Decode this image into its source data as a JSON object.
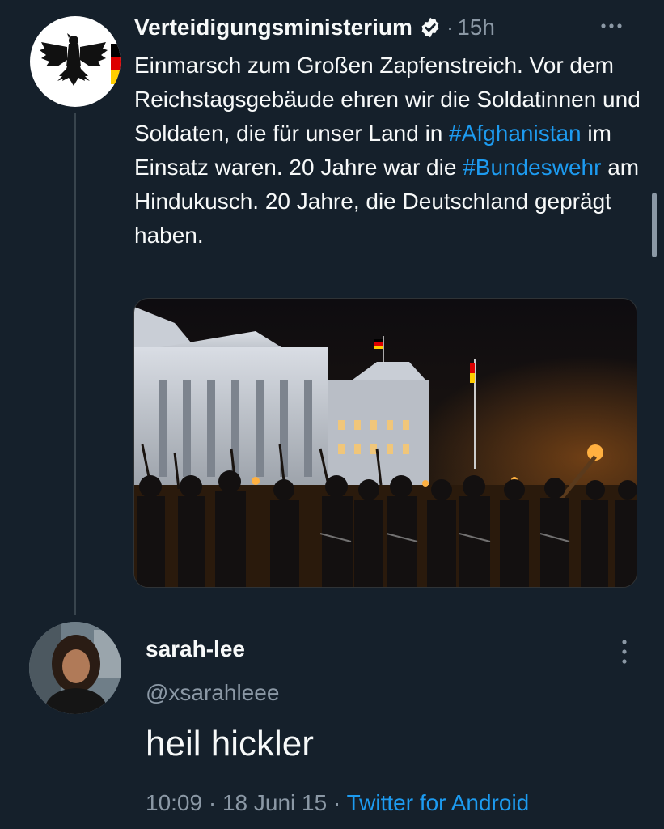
{
  "tweet": {
    "author_name": "Verteidigungsministerium",
    "time_ago": "15h",
    "separator": "·",
    "verified_icon": "verified-badge-icon",
    "more_icon": "more-horizontal-icon",
    "avatar_icon": "federal-eagle-icon",
    "text_parts": [
      {
        "text": "Einmarsch zum Großen Zapfenstreich. Vor dem Reichstagsgebäude ehren wir die Soldatinnen und Soldaten, die für unser Land in ",
        "type": "text"
      },
      {
        "text": "#Afghanistan",
        "type": "hashtag"
      },
      {
        "text": " im Einsatz waren. 20 Jahre war die ",
        "type": "text"
      },
      {
        "text": "#Bundeswehr",
        "type": "hashtag"
      },
      {
        "text": " am Hindukusch. 20 Jahre, die Deutschland geprägt haben.",
        "type": "text"
      }
    ],
    "colors": {
      "hashtag": "#1d9bf0",
      "flag_black": "#000000",
      "flag_red": "#dd0000",
      "flag_gold": "#ffce00"
    }
  },
  "reply": {
    "display_name": "sarah-lee",
    "handle": "@xsarahleee",
    "text": "heil hickler",
    "time": "10:09",
    "separator": "·",
    "date": "18 Juni 15",
    "source": "Twitter for Android",
    "more_icon": "more-vertical-icon"
  },
  "theme": {
    "background": "#15202b",
    "text_primary": "#f7f9f9",
    "text_secondary": "#8b98a5",
    "accent": "#1d9bf0"
  }
}
